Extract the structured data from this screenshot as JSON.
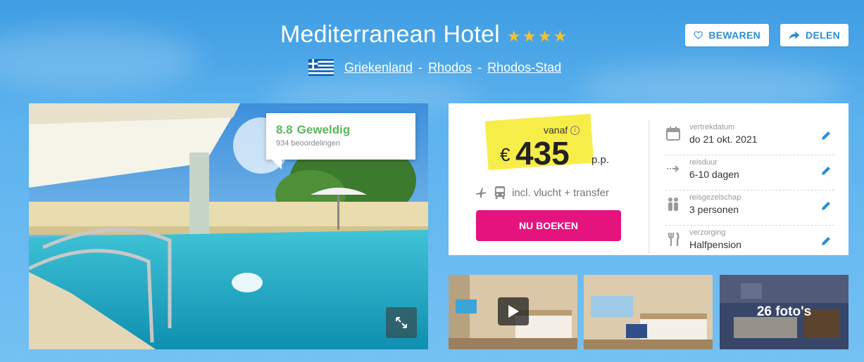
{
  "header": {
    "hotel_name": "Mediterranean Hotel",
    "stars": 4,
    "star_glyph": "★",
    "country": "Griekenland",
    "region": "Rhodos",
    "city": "Rhodos-Stad",
    "separator": "-",
    "save_label": "BEWAREN",
    "share_label": "DELEN"
  },
  "rating": {
    "score": "8.8",
    "label": "Geweldig",
    "reviews": "934 beoordelingen"
  },
  "price": {
    "vanaf_label": "vanaf",
    "info_glyph": "i",
    "currency": "€",
    "amount": "435",
    "per_person": "p.p.",
    "includes": "incl. vlucht + transfer",
    "book_label": "NU BOEKEN"
  },
  "details": [
    {
      "label": "vertrekdatum",
      "value": "do 21 okt. 2021",
      "icon": "calendar-icon"
    },
    {
      "label": "reisduur",
      "value": "6-10 dagen",
      "icon": "duration-arrow-icon"
    },
    {
      "label": "reisgezelschap",
      "value": "3 personen",
      "icon": "people-icon"
    },
    {
      "label": "verzorging",
      "value": "Halfpension",
      "icon": "cutlery-icon"
    }
  ],
  "gallery": {
    "photo_count": "26 foto's"
  },
  "colors": {
    "accent_blue": "#2b8fd6",
    "book_pink": "#e5137e",
    "rating_green": "#5cb85c",
    "star_gold": "#f6c12b",
    "price_highlight": "#f6eb3a"
  }
}
